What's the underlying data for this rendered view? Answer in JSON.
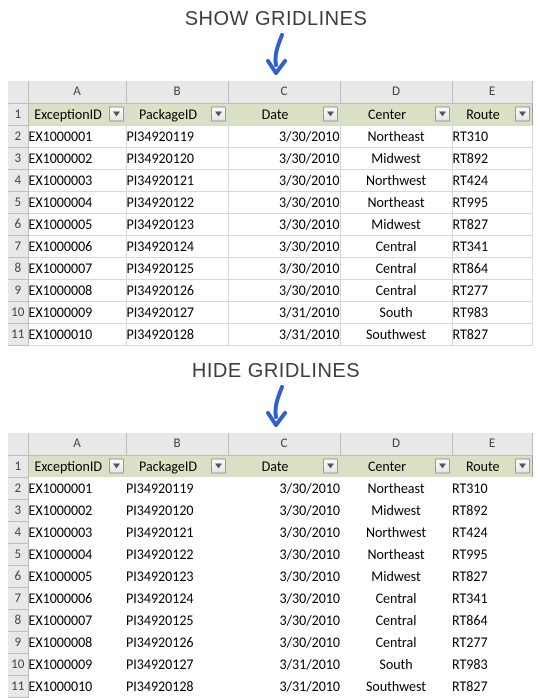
{
  "labels": {
    "show": "SHOW GRIDLINES",
    "hide": "HIDE GRIDLINES"
  },
  "columns": [
    "A",
    "B",
    "C",
    "D",
    "E"
  ],
  "headers": {
    "exceptionId": "ExceptionID",
    "packageId": "PackageID",
    "date": "Date",
    "center": "Center",
    "route": "Route"
  },
  "rows": [
    {
      "n": "2",
      "exceptionId": "EX1000001",
      "packageId": "PI34920119",
      "date": "3/30/2010",
      "center": "Northeast",
      "route": "RT310"
    },
    {
      "n": "3",
      "exceptionId": "EX1000002",
      "packageId": "PI34920120",
      "date": "3/30/2010",
      "center": "Midwest",
      "route": "RT892"
    },
    {
      "n": "4",
      "exceptionId": "EX1000003",
      "packageId": "PI34920121",
      "date": "3/30/2010",
      "center": "Northwest",
      "route": "RT424"
    },
    {
      "n": "5",
      "exceptionId": "EX1000004",
      "packageId": "PI34920122",
      "date": "3/30/2010",
      "center": "Northeast",
      "route": "RT995"
    },
    {
      "n": "6",
      "exceptionId": "EX1000005",
      "packageId": "PI34920123",
      "date": "3/30/2010",
      "center": "Midwest",
      "route": "RT827"
    },
    {
      "n": "7",
      "exceptionId": "EX1000006",
      "packageId": "PI34920124",
      "date": "3/30/2010",
      "center": "Central",
      "route": "RT341"
    },
    {
      "n": "8",
      "exceptionId": "EX1000007",
      "packageId": "PI34920125",
      "date": "3/30/2010",
      "center": "Central",
      "route": "RT864"
    },
    {
      "n": "9",
      "exceptionId": "EX1000008",
      "packageId": "PI34920126",
      "date": "3/30/2010",
      "center": "Central",
      "route": "RT277"
    },
    {
      "n": "10",
      "exceptionId": "EX1000009",
      "packageId": "PI34920127",
      "date": "3/31/2010",
      "center": "South",
      "route": "RT983"
    },
    {
      "n": "11",
      "exceptionId": "EX1000010",
      "packageId": "PI34920128",
      "date": "3/31/2010",
      "center": "Southwest",
      "route": "RT827"
    }
  ]
}
